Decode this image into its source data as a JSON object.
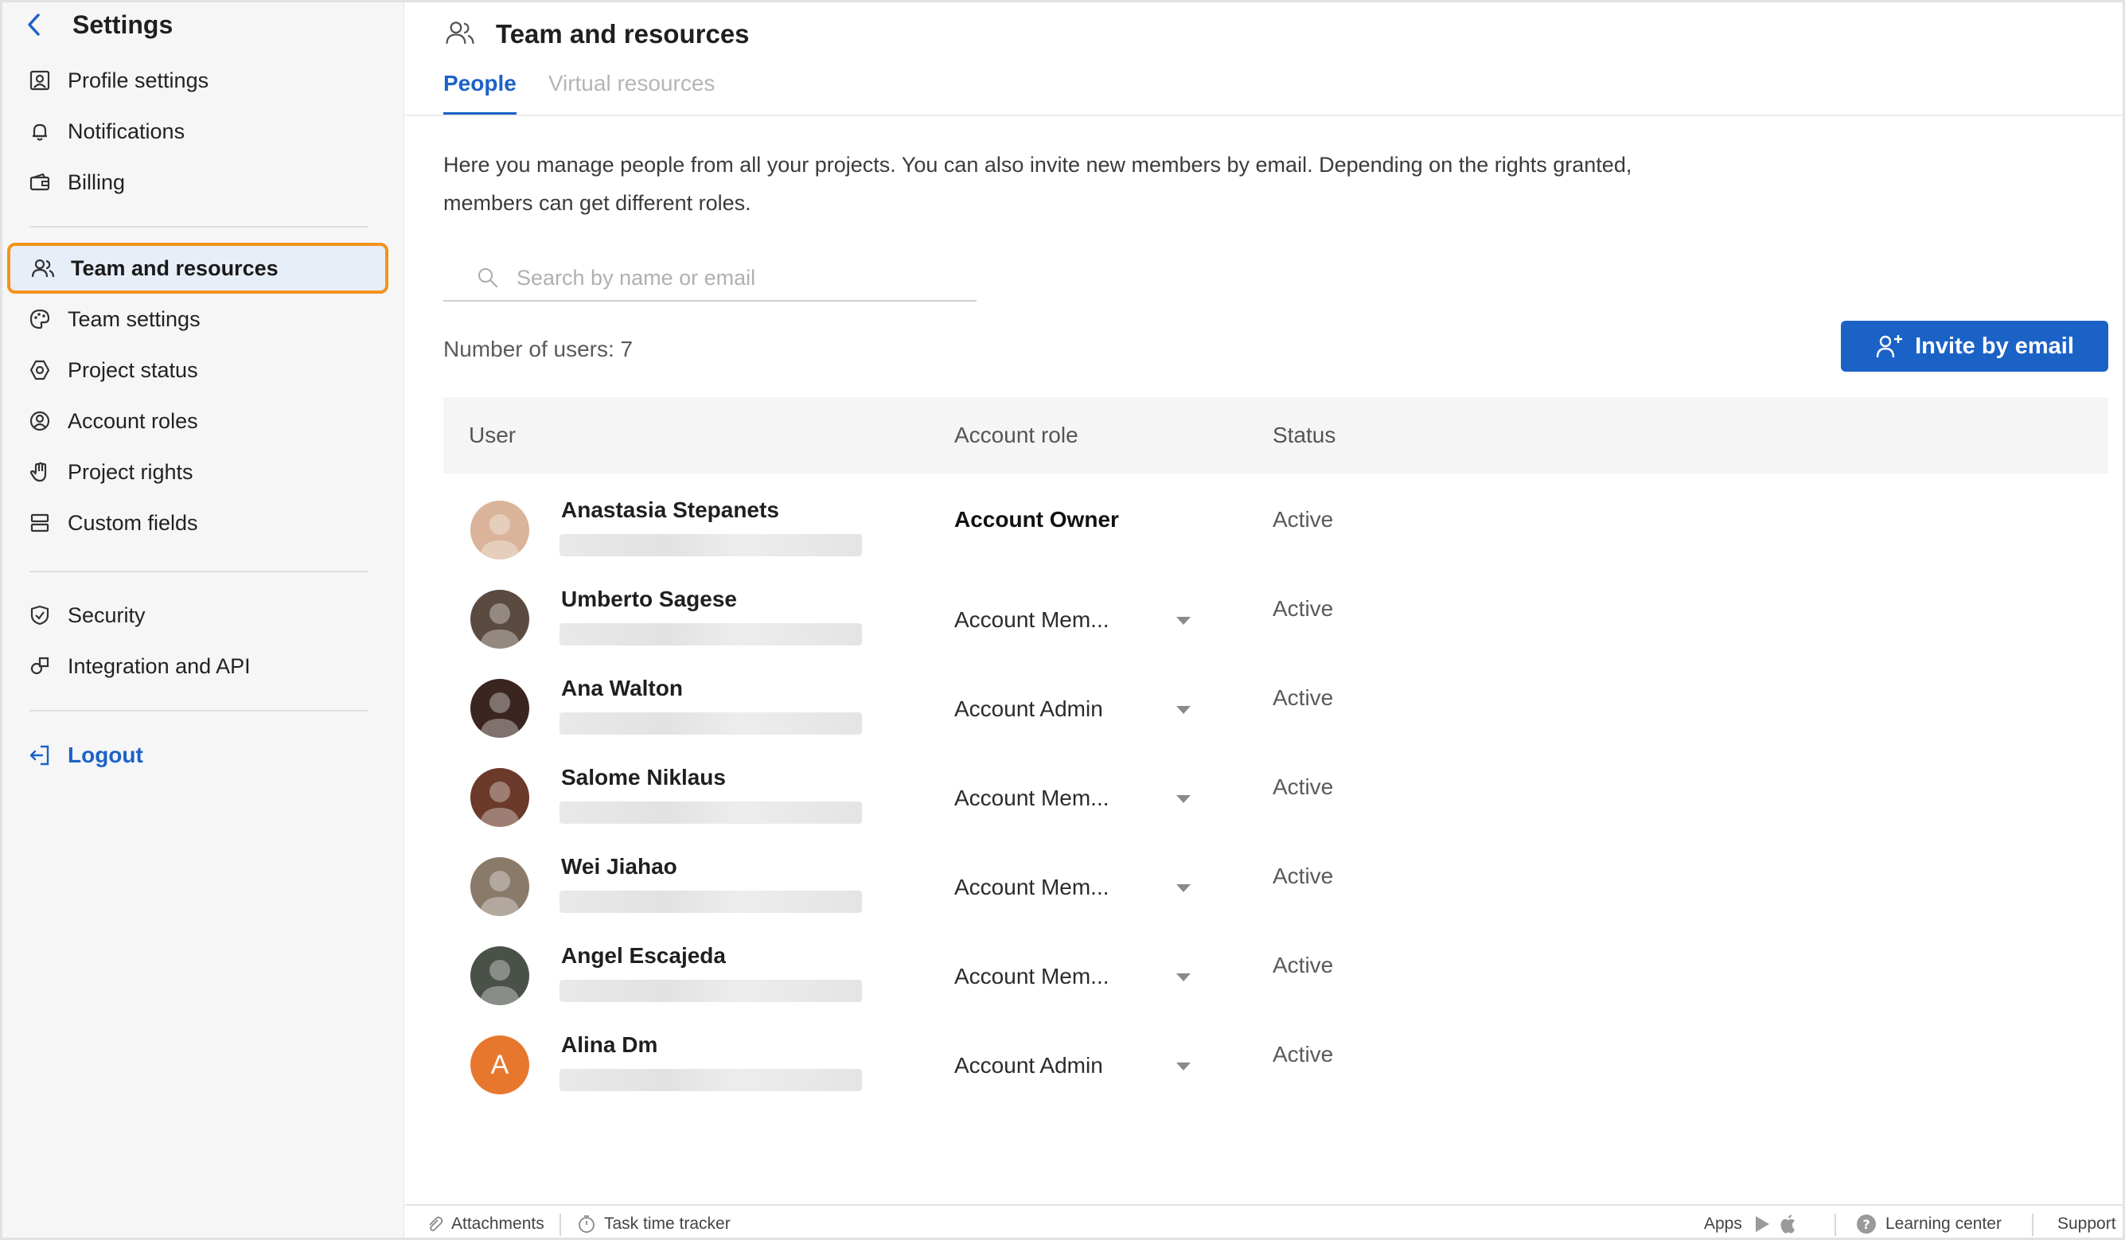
{
  "sidebar": {
    "title": "Settings",
    "group1": [
      {
        "label": "Profile settings",
        "icon": "profile-icon"
      },
      {
        "label": "Notifications",
        "icon": "bell-icon"
      },
      {
        "label": "Billing",
        "icon": "wallet-icon"
      }
    ],
    "group2": [
      {
        "label": "Team and resources",
        "icon": "team-icon"
      },
      {
        "label": "Team settings",
        "icon": "palette-icon"
      },
      {
        "label": "Project status",
        "icon": "hexagon-icon"
      },
      {
        "label": "Account roles",
        "icon": "user-circle-icon"
      },
      {
        "label": "Project rights",
        "icon": "hand-icon"
      },
      {
        "label": "Custom fields",
        "icon": "fields-icon"
      }
    ],
    "group3": [
      {
        "label": "Security",
        "icon": "shield-icon"
      },
      {
        "label": "Integration and API",
        "icon": "integration-icon"
      }
    ],
    "logout": "Logout"
  },
  "header": {
    "title": "Team and resources"
  },
  "tabs": [
    {
      "label": "People"
    },
    {
      "label": "Virtual resources"
    }
  ],
  "description": "Here you manage people from all your projects. You can also invite new members by email. Depending on the rights granted, members can get different roles.",
  "search": {
    "placeholder": "Search by name or email"
  },
  "user_count": "Number of users: 7",
  "invite_label": "Invite by email",
  "table": {
    "headers": {
      "user": "User",
      "role": "Account role",
      "status": "Status"
    },
    "rows": [
      {
        "name": "Anastasia Stepanets",
        "role": "Account Owner",
        "status": "Active",
        "avatar_color": "#d9b49a",
        "initial": ""
      },
      {
        "name": "Umberto Sagese",
        "role": "Account Mem...",
        "status": "Active",
        "avatar_color": "#5a4a40",
        "initial": ""
      },
      {
        "name": "Ana Walton",
        "role": "Account Admin",
        "status": "Active",
        "avatar_color": "#3b2520",
        "initial": ""
      },
      {
        "name": "Salome Niklaus",
        "role": "Account Mem...",
        "status": "Active",
        "avatar_color": "#6b3a2a",
        "initial": ""
      },
      {
        "name": "Wei Jiahao",
        "role": "Account Mem...",
        "status": "Active",
        "avatar_color": "#8a7a6a",
        "initial": ""
      },
      {
        "name": "Angel Escajeda",
        "role": "Account Mem...",
        "status": "Active",
        "avatar_color": "#4a5148",
        "initial": ""
      },
      {
        "name": "Alina Dm",
        "role": "Account Admin",
        "status": "Active",
        "avatar_color": "#e8772e",
        "initial": "A"
      }
    ]
  },
  "footer": {
    "attachments": "Attachments",
    "time_tracker": "Task time tracker",
    "apps": "Apps",
    "learning": "Learning center",
    "support": "Support"
  },
  "colors": {
    "accent": "#1b62c7",
    "highlight": "#f3931d"
  }
}
